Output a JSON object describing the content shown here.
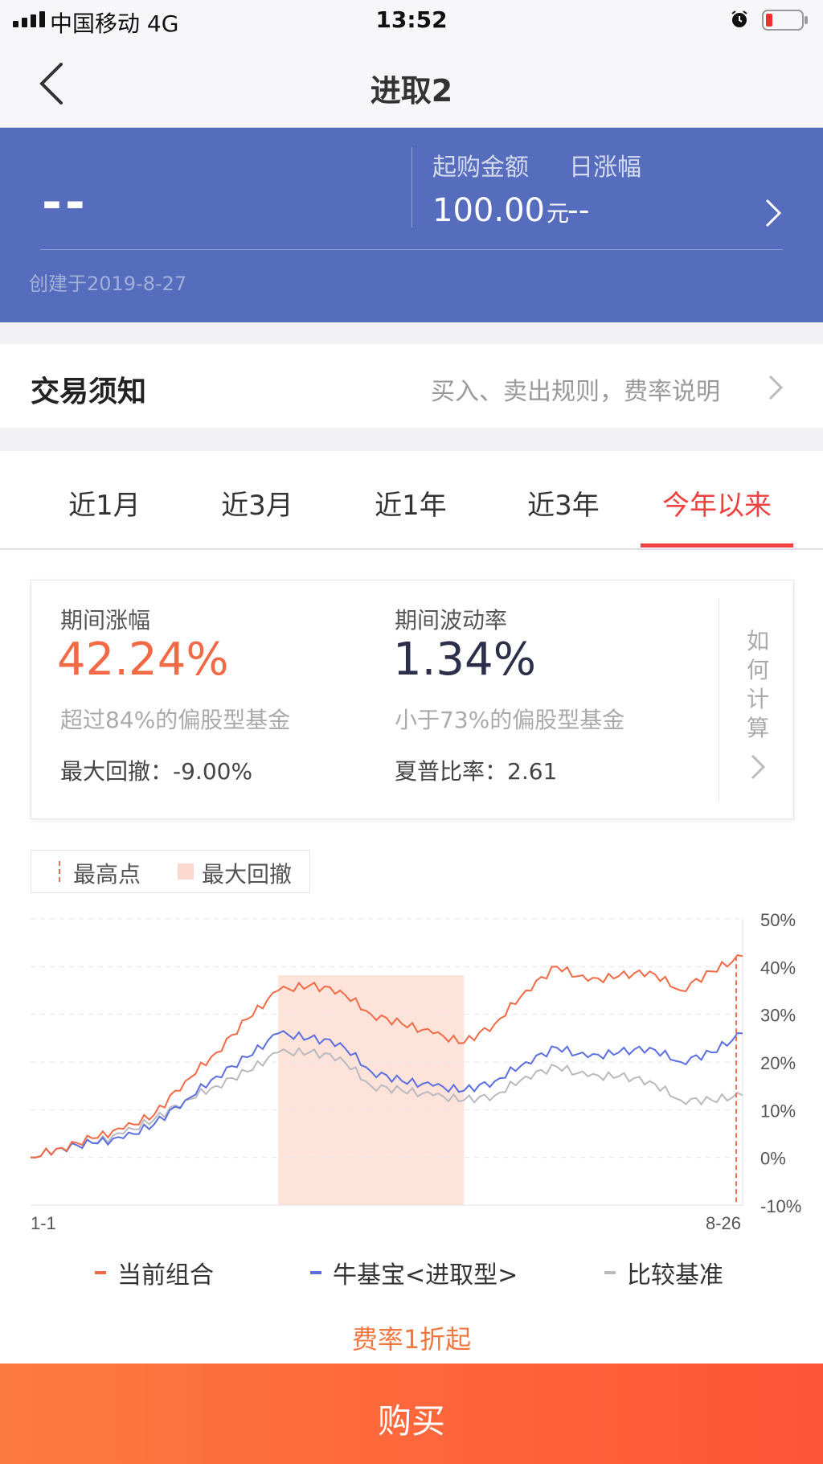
{
  "status_bar": {
    "carrier": "中国移动  4G",
    "time": "13:52"
  },
  "nav": {
    "title": "进取2"
  },
  "header": {
    "nav_value": "--",
    "min_purchase_label": "起购金额",
    "daily_change_label": "日涨幅",
    "min_purchase_amount": "100.00",
    "min_purchase_unit": "元",
    "daily_change_value": "--",
    "created": "创建于2019-8-27"
  },
  "trade_notice": {
    "title": "交易须知",
    "link": "买入、卖出规则，费率说明"
  },
  "tabs": [
    {
      "label": "近1月"
    },
    {
      "label": "近3月"
    },
    {
      "label": "近1年"
    },
    {
      "label": "近3年"
    },
    {
      "label": "今年以来"
    }
  ],
  "active_tab": 4,
  "stats": {
    "period_change_label": "期间涨幅",
    "period_change_value": "42.24%",
    "period_change_rank": "超过84%的偏股型基金",
    "max_drawdown": "最大回撤：-9.00%",
    "volatility_label": "期间波动率",
    "volatility_value": "1.34%",
    "volatility_rank": "小于73%的偏股型基金",
    "sharpe": "夏普比率：2.61",
    "how_to_calc": [
      "如",
      "何",
      "计",
      "算"
    ]
  },
  "marker_legend": {
    "peak": "最高点",
    "max_drawdown": "最大回撤"
  },
  "chart_data": {
    "type": "line",
    "x_start_label": "1-1",
    "x_end_label": "8-26",
    "y_ticks": [
      "50%",
      "40%",
      "30%",
      "20%",
      "10%",
      "0%",
      "-10%"
    ],
    "ylim": [
      -10,
      50
    ],
    "x": [
      "1-1",
      "1-10",
      "1-20",
      "2-1",
      "2-15",
      "2-25",
      "3-5",
      "3-15",
      "3-25",
      "4-5",
      "4-15",
      "4-25",
      "5-5",
      "5-15",
      "5-25",
      "6-5",
      "6-15",
      "6-25",
      "7-5",
      "7-15",
      "7-25",
      "8-5",
      "8-15",
      "8-26"
    ],
    "series": [
      {
        "name": "当前组合",
        "color": "#f26a45",
        "values": [
          0,
          2,
          4,
          6,
          9,
          16,
          22,
          29,
          35,
          36,
          35,
          30,
          28,
          26,
          24,
          28,
          35,
          40,
          37,
          38,
          39,
          35,
          39,
          42.2
        ]
      },
      {
        "name": "牛基宝<进取型>",
        "color": "#5b6fe0",
        "values": [
          0,
          2,
          3,
          4,
          7,
          12,
          17,
          21,
          26,
          25,
          24,
          18,
          16,
          15,
          14,
          16,
          20,
          23,
          21,
          22,
          23,
          20,
          22,
          26
        ]
      },
      {
        "name": "比较基准",
        "color": "#b9b9c0",
        "values": [
          0,
          2,
          3,
          5,
          8,
          12,
          15,
          18,
          22,
          22,
          21,
          15,
          14,
          13,
          12,
          13,
          17,
          19,
          17,
          17,
          16,
          12,
          12,
          13
        ]
      }
    ],
    "drawdown_range": [
      "3-25",
      "5-25"
    ],
    "peak": "8-26",
    "legend_position": "bottom",
    "grid": true
  },
  "promo": "费率1折起",
  "buy_button": "购买"
}
